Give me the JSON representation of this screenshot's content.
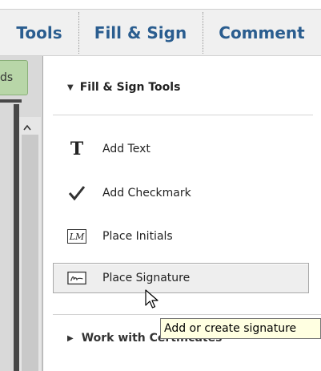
{
  "tabs": [
    {
      "label": "Tools"
    },
    {
      "label": "Fill & Sign"
    },
    {
      "label": "Comment"
    }
  ],
  "left_button": {
    "label": "ds"
  },
  "panel": {
    "section_title": "Fill & Sign Tools",
    "items": [
      {
        "label": "Add Text",
        "icon": "text-t-icon"
      },
      {
        "label": "Add Checkmark",
        "icon": "checkmark-icon"
      },
      {
        "label": "Place Initials",
        "icon": "initials-icon"
      },
      {
        "label": "Place Signature",
        "icon": "signature-icon"
      }
    ],
    "section2_title": "Work with Certificates"
  },
  "tooltip": {
    "text": "Add or create signature"
  },
  "colors": {
    "tab_text": "#2a5d8f",
    "green_button": "#b8d6a8",
    "tooltip_bg": "#ffffe1"
  }
}
